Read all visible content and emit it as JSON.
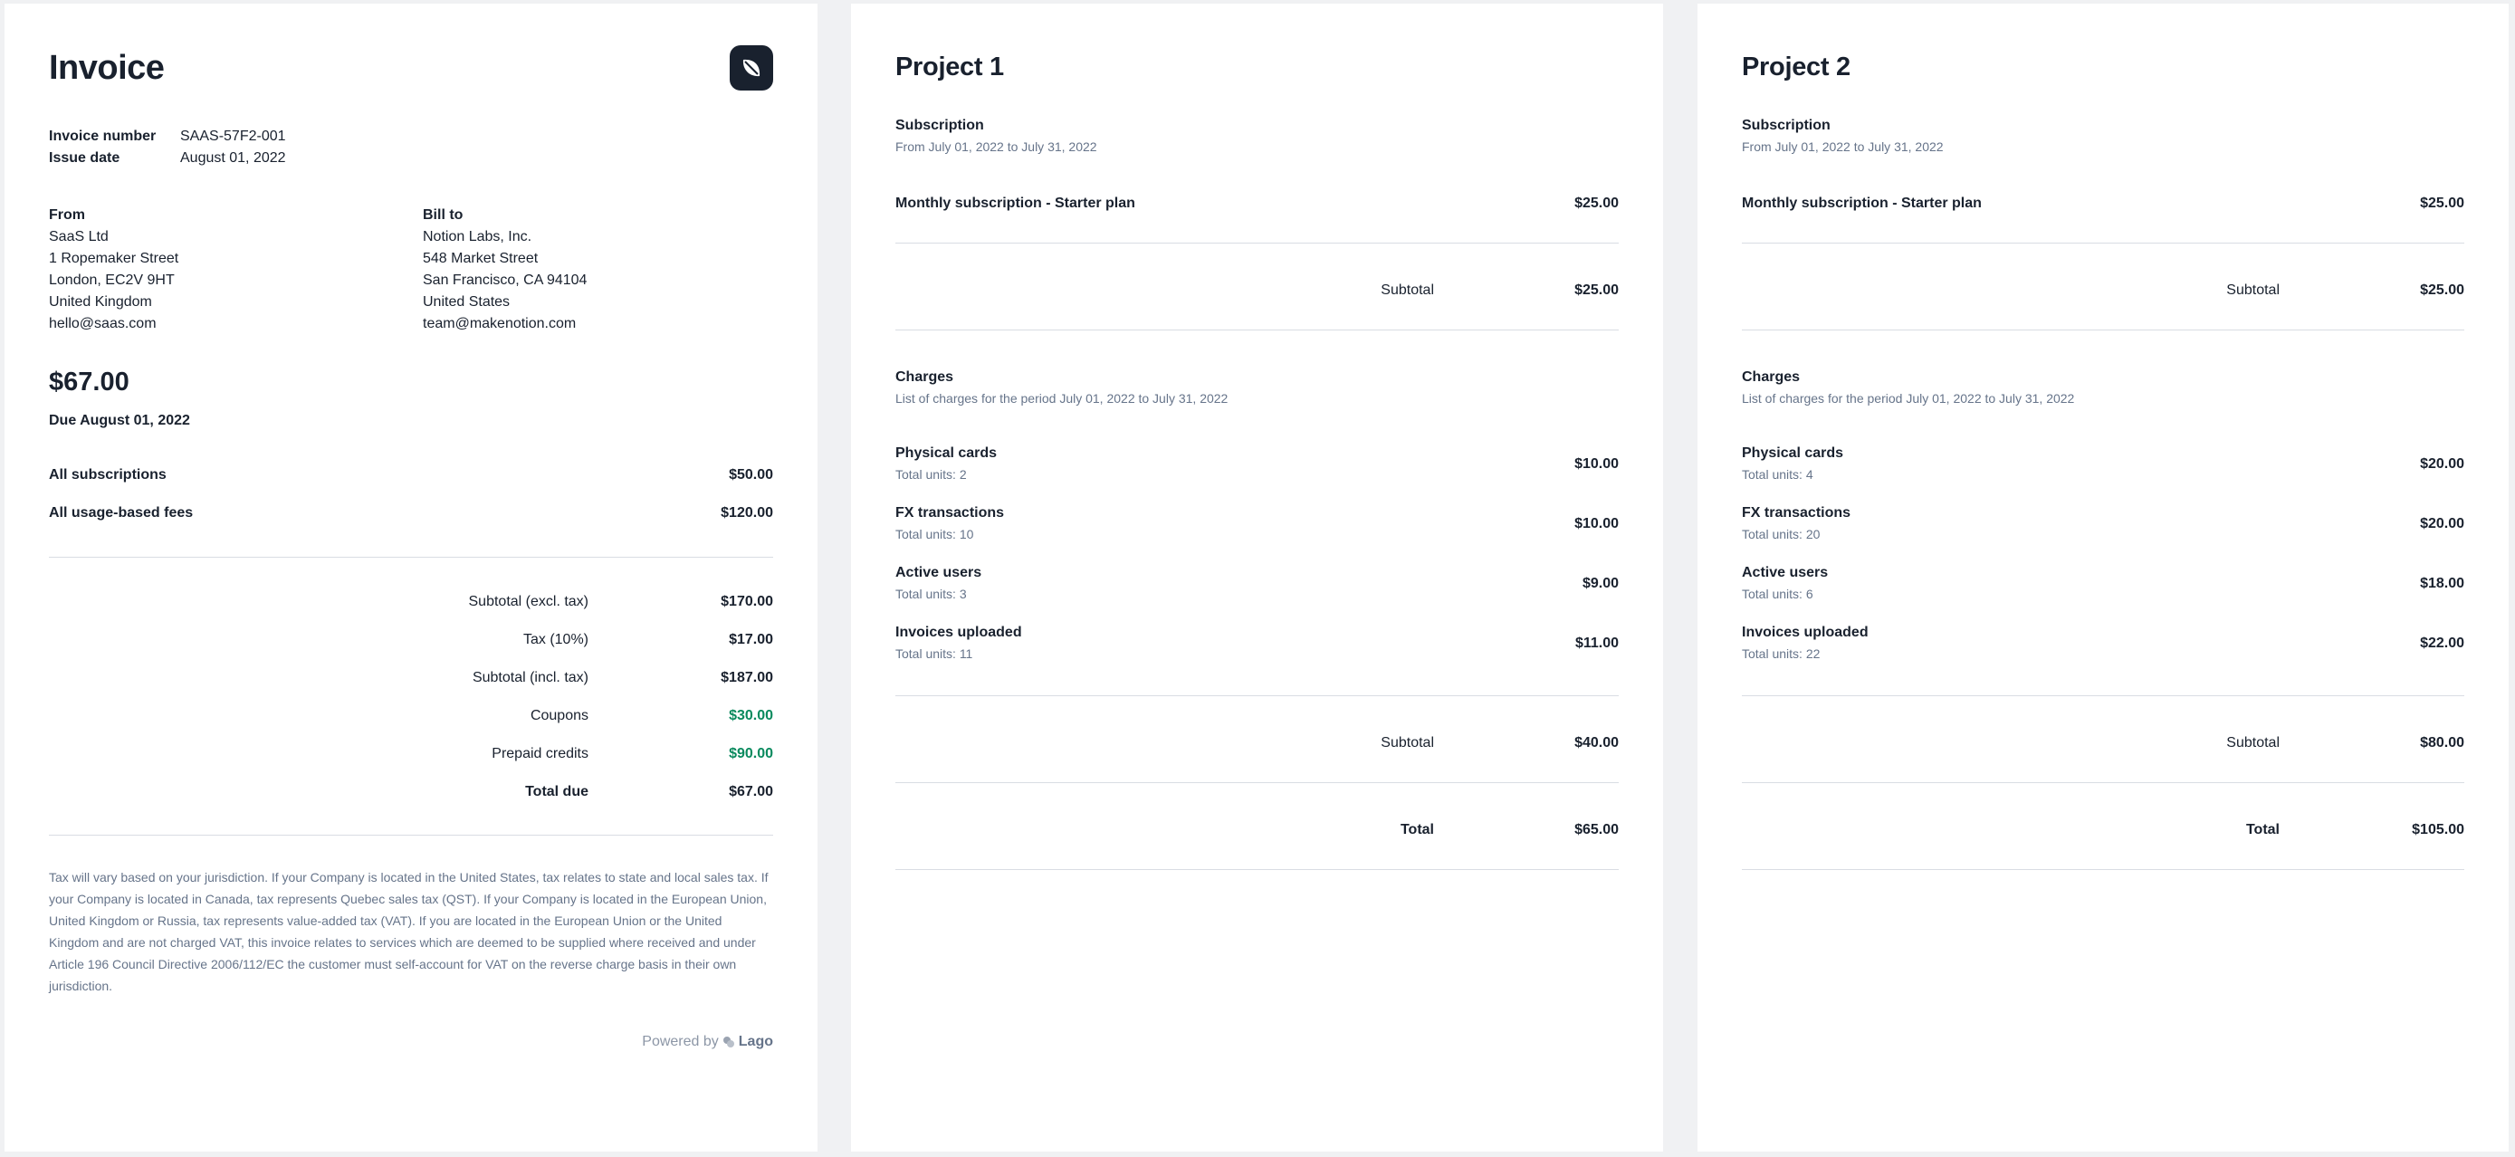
{
  "invoice": {
    "title": "Invoice",
    "logo_icon": "leaf-icon",
    "meta": [
      {
        "label": "Invoice number",
        "value": "SAAS-57F2-001"
      },
      {
        "label": "Issue date",
        "value": "August 01, 2022"
      }
    ],
    "from": {
      "header": "From",
      "lines": [
        "SaaS Ltd",
        "1 Ropemaker Street",
        "London, EC2V 9HT",
        "United Kingdom",
        "hello@saas.com"
      ]
    },
    "bill_to": {
      "header": "Bill to",
      "lines": [
        "Notion Labs, Inc.",
        "548 Market Street",
        "San Francisco, CA 94104",
        "United States",
        "team@makenotion.com"
      ]
    },
    "amount_due": "$67.00",
    "due_text": "Due August 01, 2022",
    "lines": [
      {
        "label": "All subscriptions",
        "value": "$50.00"
      },
      {
        "label": "All usage-based fees",
        "value": "$120.00"
      }
    ],
    "totals": [
      {
        "label": "Subtotal (excl. tax)",
        "value": "$170.00"
      },
      {
        "label": "Tax (10%)",
        "value": "$17.00"
      },
      {
        "label": "Subtotal (incl. tax)",
        "value": "$187.00"
      },
      {
        "label": "Coupons",
        "value": "$30.00"
      },
      {
        "label": "Prepaid credits",
        "value": "$90.00"
      },
      {
        "label": "Total due",
        "value": "$67.00"
      }
    ],
    "tax_note": "Tax will vary based on your jurisdiction. If your Company is located in the United States, tax relates to state and local sales tax. If your Company is located in Canada, tax represents Quebec sales tax (QST). If your Company is located in the European Union, United Kingdom or Russia, tax represents value-added tax (VAT). If you are located in the European Union or the United Kingdom and are not charged VAT, this invoice relates to services which are deemed to be supplied where received and under Article 196 Council Directive 2006/112/EC the customer must self-account for VAT on the reverse charge basis in their own jurisdiction.",
    "powered_by": "Powered by",
    "powered_brand": "Lago"
  },
  "projects": [
    {
      "title": "Project 1",
      "subscription_title": "Subscription",
      "subscription_period": "From July 01, 2022 to July 31, 2022",
      "subscription_item": "Monthly subscription - Starter plan",
      "subscription_amount": "$25.00",
      "subscription_subtotal_label": "Subtotal",
      "subscription_subtotal": "$25.00",
      "charges_title": "Charges",
      "charges_period": "List of charges for the period July 01, 2022 to July 31, 2022",
      "charges": [
        {
          "name": "Physical cards",
          "units": "Total units: 2",
          "amount": "$10.00"
        },
        {
          "name": "FX transactions",
          "units": "Total units: 10",
          "amount": "$10.00"
        },
        {
          "name": "Active users",
          "units": "Total units: 3",
          "amount": "$9.00"
        },
        {
          "name": "Invoices uploaded",
          "units": "Total units: 11",
          "amount": "$11.00"
        }
      ],
      "charges_subtotal_label": "Subtotal",
      "charges_subtotal": "$40.00",
      "total_label": "Total",
      "total": "$65.00"
    },
    {
      "title": "Project 2",
      "subscription_title": "Subscription",
      "subscription_period": "From July 01, 2022 to July 31, 2022",
      "subscription_item": "Monthly subscription - Starter plan",
      "subscription_amount": "$25.00",
      "subscription_subtotal_label": "Subtotal",
      "subscription_subtotal": "$25.00",
      "charges_title": "Charges",
      "charges_period": "List of charges for the period July 01, 2022 to July 31, 2022",
      "charges": [
        {
          "name": "Physical cards",
          "units": "Total units: 4",
          "amount": "$20.00"
        },
        {
          "name": "FX transactions",
          "units": "Total units: 20",
          "amount": "$20.00"
        },
        {
          "name": "Active users",
          "units": "Total units: 6",
          "amount": "$18.00"
        },
        {
          "name": "Invoices uploaded",
          "units": "Total units: 22",
          "amount": "$22.00"
        }
      ],
      "charges_subtotal_label": "Subtotal",
      "charges_subtotal": "$80.00",
      "total_label": "Total",
      "total": "$105.00"
    }
  ],
  "colors": {
    "accent_dark": "#19212e",
    "credit_green": "#0a8a5e",
    "muted_text": "#66748a"
  }
}
